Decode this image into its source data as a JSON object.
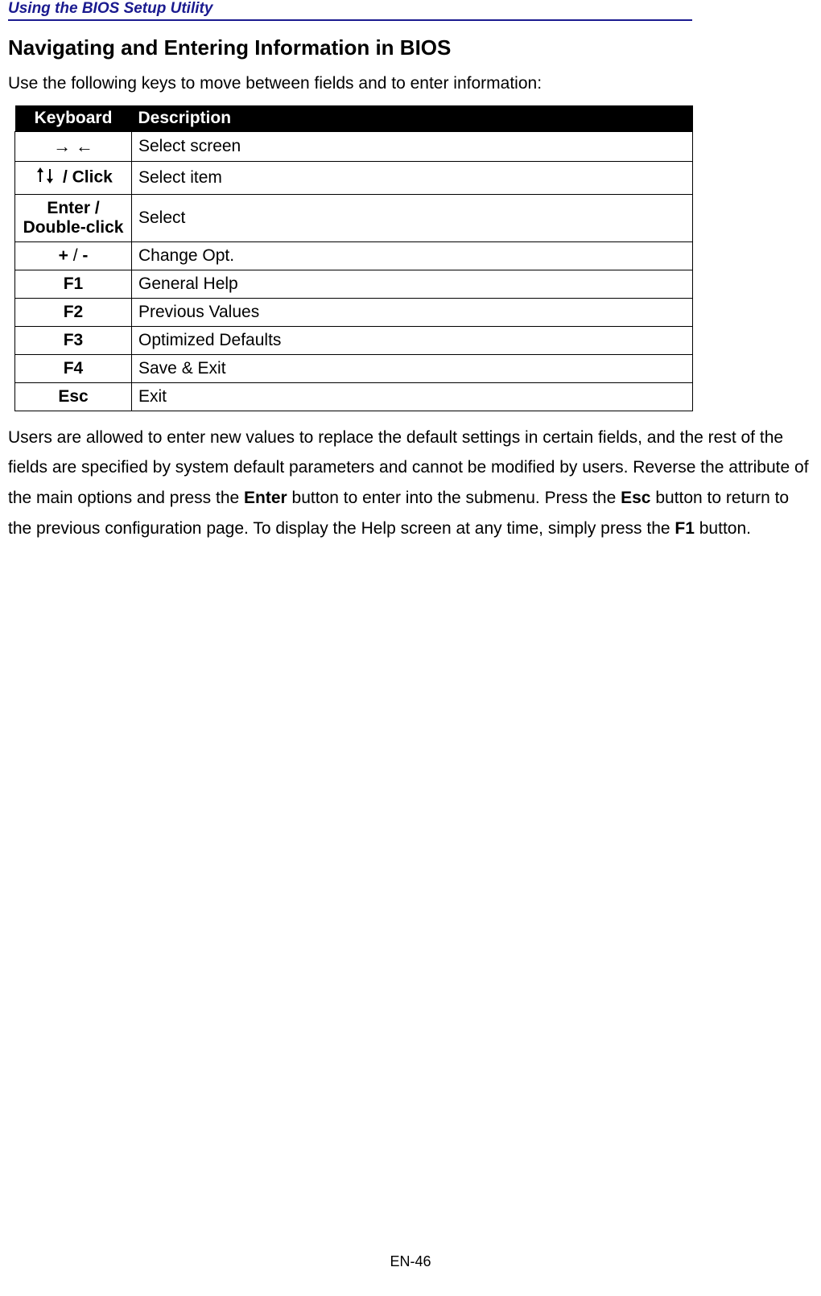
{
  "header": {
    "title": "Using the BIOS Setup Utility"
  },
  "section": {
    "heading": "Navigating and Entering Information in BIOS",
    "intro": "Use the following keys to move between fields and to enter information:"
  },
  "table": {
    "headers": {
      "keyboard": "Keyboard",
      "description": "Description"
    },
    "rows": [
      {
        "key_html": "arrows_lr",
        "desc": "Select screen"
      },
      {
        "key_html": "arrows_ud_click",
        "key_suffix": " / Click",
        "desc": "Select item"
      },
      {
        "key_html": "enter_dbl",
        "key_line1": "Enter /",
        "key_line2": "Double-click",
        "desc": "Select"
      },
      {
        "key_html": "plus_minus",
        "key_plus": "+",
        "key_slash": " / ",
        "key_minus": "-",
        "desc": "Change Opt."
      },
      {
        "key_html": "plain",
        "key": "F1",
        "desc": "General Help"
      },
      {
        "key_html": "plain",
        "key": "F2",
        "desc": "Previous Values"
      },
      {
        "key_html": "plain",
        "key": "F3",
        "desc": "Optimized Defaults"
      },
      {
        "key_html": "plain",
        "key": "F4",
        "desc": "Save & Exit"
      },
      {
        "key_html": "plain",
        "key": "Esc",
        "desc": "Exit"
      }
    ]
  },
  "paragraph": {
    "p1": "Users are allowed to enter new values to replace the default settings in certain fields, and the rest of the fields are specified by system default parameters and cannot be modified by users. Reverse the attribute of the main options and press the ",
    "b1": "Enter",
    "p2": " button to enter into the submenu. Press the ",
    "b2": "Esc",
    "p3": " button to return to the previous configuration page. To display the Help screen at any time, simply press the ",
    "b3": "F1",
    "p4": " button."
  },
  "footer": {
    "page": "EN-46"
  }
}
